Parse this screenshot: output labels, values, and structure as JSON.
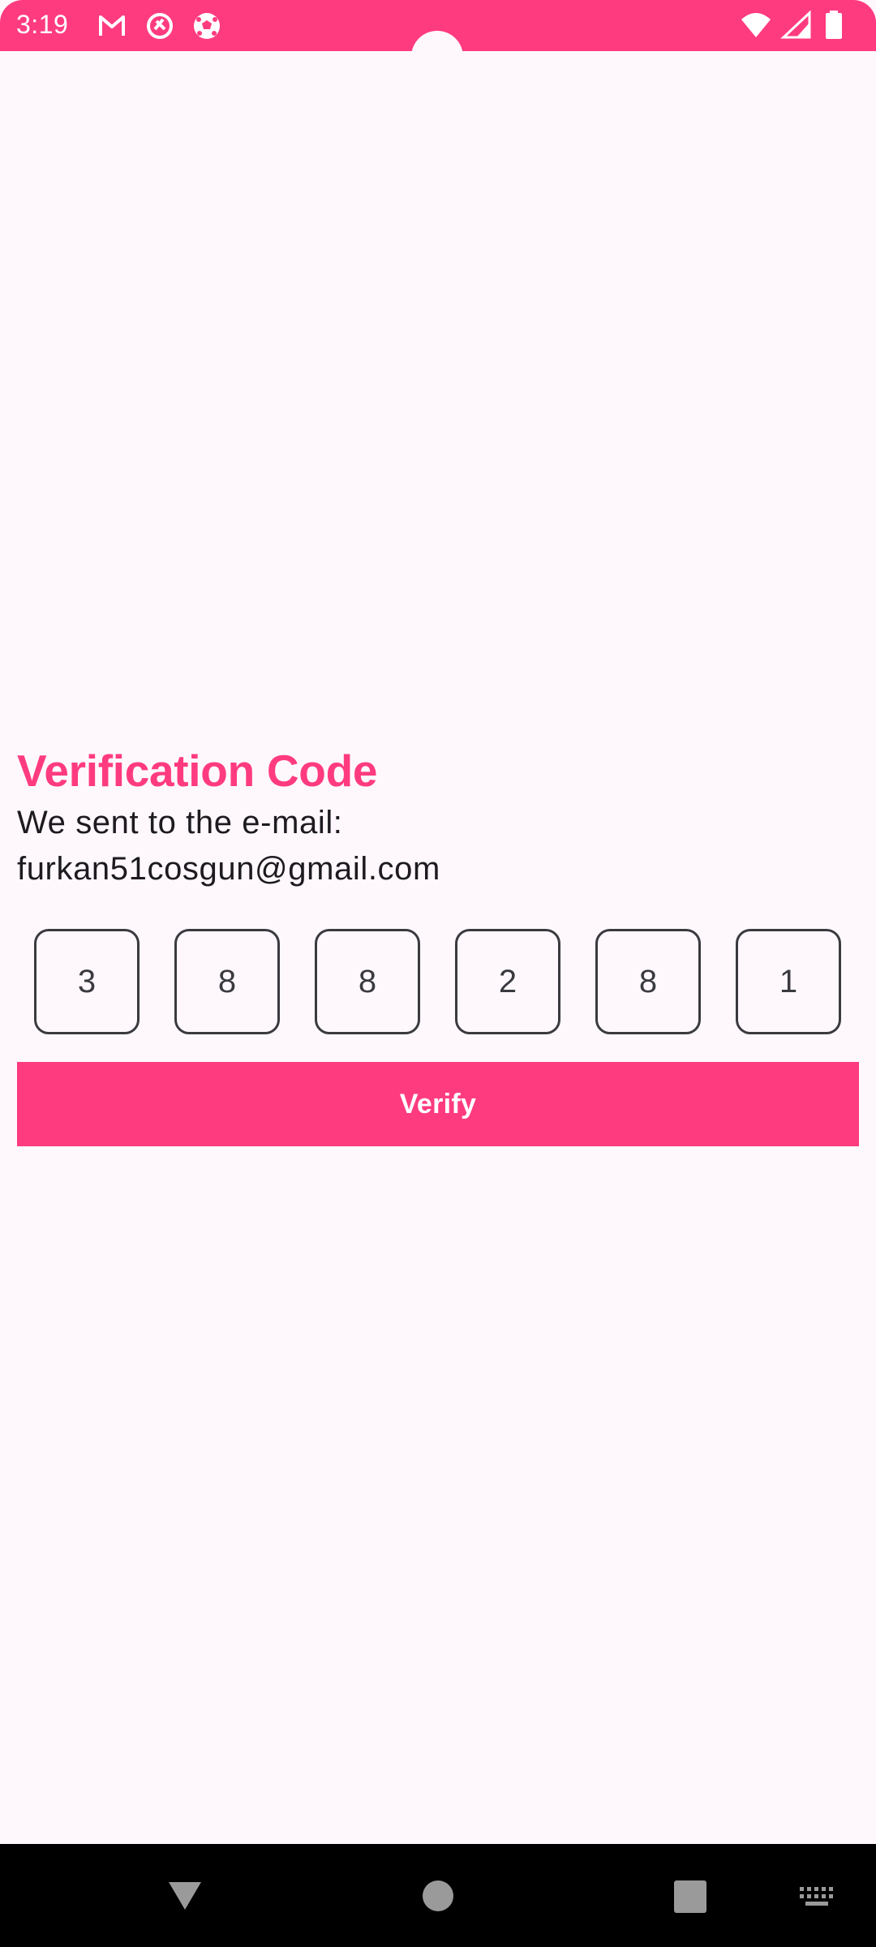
{
  "status_bar": {
    "time": "3:19",
    "notification_icons": [
      "gmail-icon",
      "blocked-icon",
      "soccer-ball-icon"
    ],
    "system_icons": [
      "wifi-icon",
      "cellular-signal-icon",
      "battery-icon"
    ],
    "background_color": "#ff3b80"
  },
  "verification": {
    "title": "Verification Code",
    "subtitle": "We sent to the e-mail:",
    "email": "furkan51cosgun@gmail.com",
    "code_digits": [
      "3",
      "8",
      "8",
      "2",
      "8",
      "1"
    ],
    "verify_label": "Verify"
  },
  "colors": {
    "accent": "#ff3b80",
    "background": "#fef8fc",
    "text": "#1d1b20"
  },
  "nav_bar": {
    "buttons": [
      "back-icon",
      "home-icon",
      "recents-icon",
      "keyboard-icon"
    ]
  }
}
